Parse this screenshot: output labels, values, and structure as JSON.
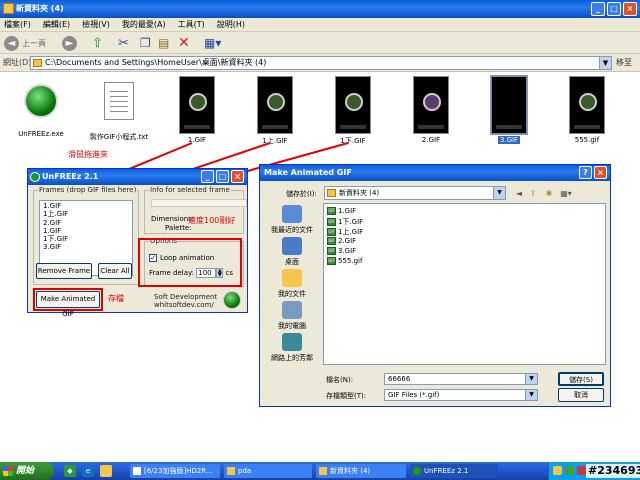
{
  "explorer": {
    "title": "新資料夾 (4)",
    "menu": [
      "檔案(F)",
      "編輯(E)",
      "檢視(V)",
      "我的最愛(A)",
      "工具(T)",
      "說明(H)"
    ],
    "toolbar": {
      "back": "上一頁",
      "forward": ""
    },
    "address_label": "網址(D)",
    "address": "C:\\Documents and Settings\\HomeUser\\桌面\\新資料夾 (4)",
    "go": "移至",
    "files": [
      {
        "label": "UnFREEz.exe"
      },
      {
        "label": "製作GIF小程式.txt"
      },
      {
        "label": "1.GIF"
      },
      {
        "label": "1上.GIF"
      },
      {
        "label": "1下.GIF"
      },
      {
        "label": "2.GIF"
      },
      {
        "label": "3.GIF"
      },
      {
        "label": "555.gif"
      }
    ]
  },
  "annotations": {
    "drag": "滑鼠拖進來",
    "speed": "速度100剛好",
    "save": "存檔"
  },
  "unfreez": {
    "title": "UnFREEz 2.1",
    "frames_label": "Frames (drop GIF files here)",
    "frames": [
      "1.GIF",
      "1上.GIF",
      "2.GIF",
      "1.GIF",
      "1下.GIF",
      "3.GIF"
    ],
    "remove_frame": "Remove Frame",
    "clear_all": "Clear All",
    "info_label": "Info for selected frame",
    "dimensions": "Dimensions:",
    "palette": "Palette:",
    "options_label": "Options",
    "loop": "Loop animation",
    "frame_delay_label": "Frame delay:",
    "frame_delay": "100",
    "frame_delay_unit": "cs",
    "make_gif": "Make Animated GIF",
    "soft_line1": "Soft Development",
    "soft_line2": "whitsoftdev.com/"
  },
  "dialog": {
    "title": "Make Animated GIF",
    "save_in_label": "儲存於(I):",
    "save_in": "新資料夾 (4)",
    "places": [
      "我最近的文件",
      "桌面",
      "我的文件",
      "我的電腦",
      "網路上的芳鄰"
    ],
    "files": [
      "1.GIF",
      "1下.GIF",
      "1上.GIF",
      "2.GIF",
      "3.GIF",
      "555.gif"
    ],
    "filename_label": "檔名(N):",
    "filename": "66666",
    "filetype_label": "存檔類型(T):",
    "filetype": "GIF Files (*.gif)",
    "save": "儲存(S)",
    "cancel": "取消"
  },
  "taskbar": {
    "start": "開始",
    "tasks": [
      "[6/23加強版]HD2R...",
      "pda",
      "新資料夾 (4)",
      "UnFREEz 2.1"
    ]
  },
  "watermark": "#234693"
}
